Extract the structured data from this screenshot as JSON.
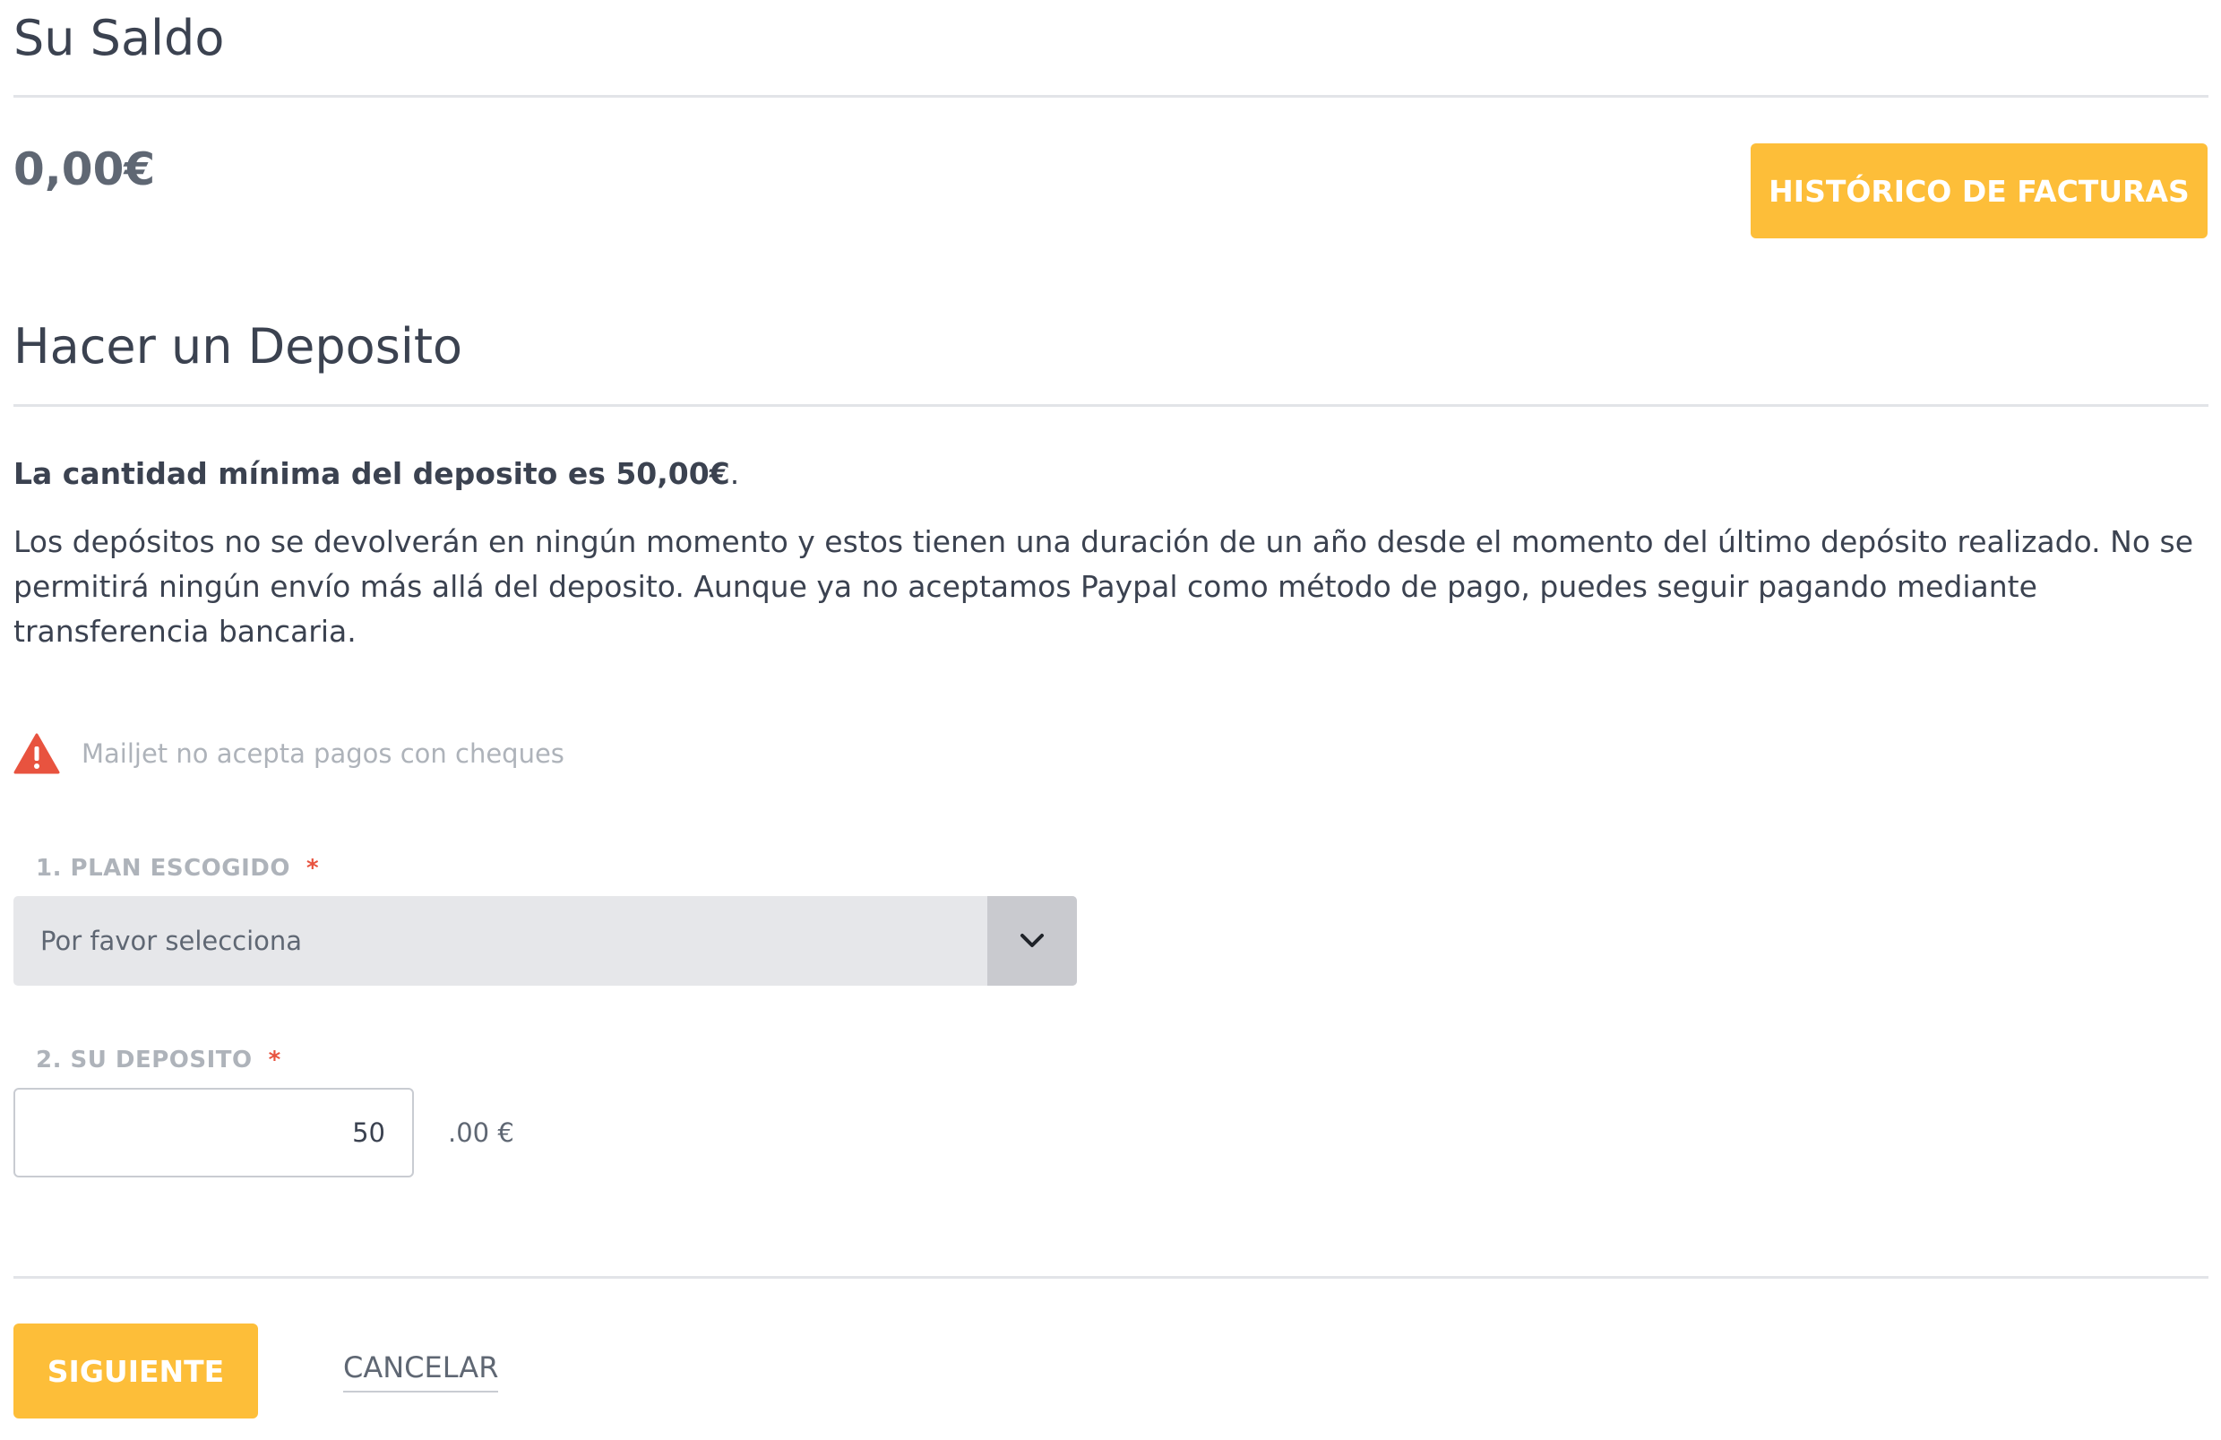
{
  "balance_section": {
    "title": "Su Saldo",
    "amount": "0,00€",
    "history_button_label": "HISTÓRICO DE FACTURAS"
  },
  "deposit_section": {
    "title": "Hacer un Deposito",
    "minimum_notice": "La cantidad mínima del deposito es 50,00€",
    "minimum_notice_suffix": ".",
    "description": "Los depósitos no se devolverán en ningún momento y estos tienen una duración de un año desde el momento del último depósito realizado. No se permitirá ningún envío más allá del deposito. Aunque ya no aceptamos Paypal como método de pago, puedes seguir pagando mediante transferencia bancaria.",
    "warning_icon": "warning-triangle-icon",
    "warning_text": "Mailjet no acepta pagos con cheques"
  },
  "form": {
    "plan": {
      "label": "1. PLAN ESCOGIDO",
      "required_marker": "*",
      "selected_value": "Por favor selecciona",
      "dropdown_icon": "chevron-down-icon"
    },
    "deposit": {
      "label": "2. SU DEPOSITO",
      "required_marker": "*",
      "value": "50",
      "suffix": ".00 €"
    }
  },
  "actions": {
    "next_label": "SIGUIENTE",
    "cancel_label": "CANCELAR"
  },
  "colors": {
    "accent_yellow": "#fdbe39",
    "required_red": "#e8533f",
    "warning_red": "#e8533f",
    "text_dark": "#3b4250",
    "text_muted": "#aeb3ba"
  }
}
